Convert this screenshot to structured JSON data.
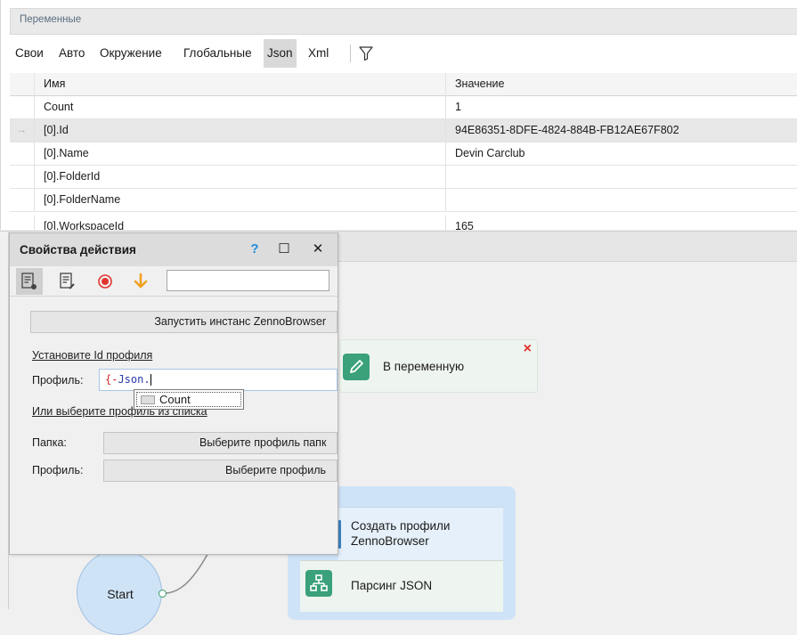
{
  "variables_panel": {
    "title": "Переменные",
    "tabs": [
      "Свои",
      "Авто",
      "Окружение",
      "Глобальные",
      "Json",
      "Xml"
    ],
    "active_tab": "Json",
    "columns": {
      "name": "Имя",
      "value": "Значение"
    },
    "rows": [
      {
        "name": "Count",
        "value": "1"
      },
      {
        "name": "[0].Id",
        "value": "94E86351-8DFE-4824-884B-FB12AE67F802",
        "selected": true
      },
      {
        "name": "[0].Name",
        "value": "Devin Carclub"
      },
      {
        "name": "[0].FolderId",
        "value": ""
      },
      {
        "name": "[0].FolderName",
        "value": ""
      },
      {
        "name": "[0].WorkspaceId",
        "value": "165"
      }
    ],
    "row_marker": "→"
  },
  "properties_dialog": {
    "title": "Свойства действия",
    "help_glyph": "?",
    "maximize_glyph": "☐",
    "close_glyph": "✕",
    "search_value": "",
    "launch_button": "Запустить инстанс ZennoBrowser",
    "set_profile_id_link": "Установите Id профиля",
    "profile_label": "Профиль:",
    "profile_input": {
      "open_brace": "{-",
      "keyword": "Json",
      "dot": "."
    },
    "choose_from_list_link": "Или выберите профиль из списка",
    "folder_label": "Папка:",
    "folder_button": "Выберите профиль папк",
    "profile_label_2": "Профиль:",
    "profile_button": "Выберите профиль"
  },
  "autocomplete": {
    "item": "Count"
  },
  "canvas": {
    "block_to_variable": {
      "label": "В переменную",
      "close": "×"
    },
    "group_items": [
      "Создать профили ZennoBrowser",
      "Парсинг JSON"
    ],
    "start_node": "Start"
  },
  "colors": {
    "accent_green": "#3aa17a",
    "group_blue": "#cfe3f7",
    "close_red": "#e0302a",
    "help_blue": "#1f8fe0"
  }
}
